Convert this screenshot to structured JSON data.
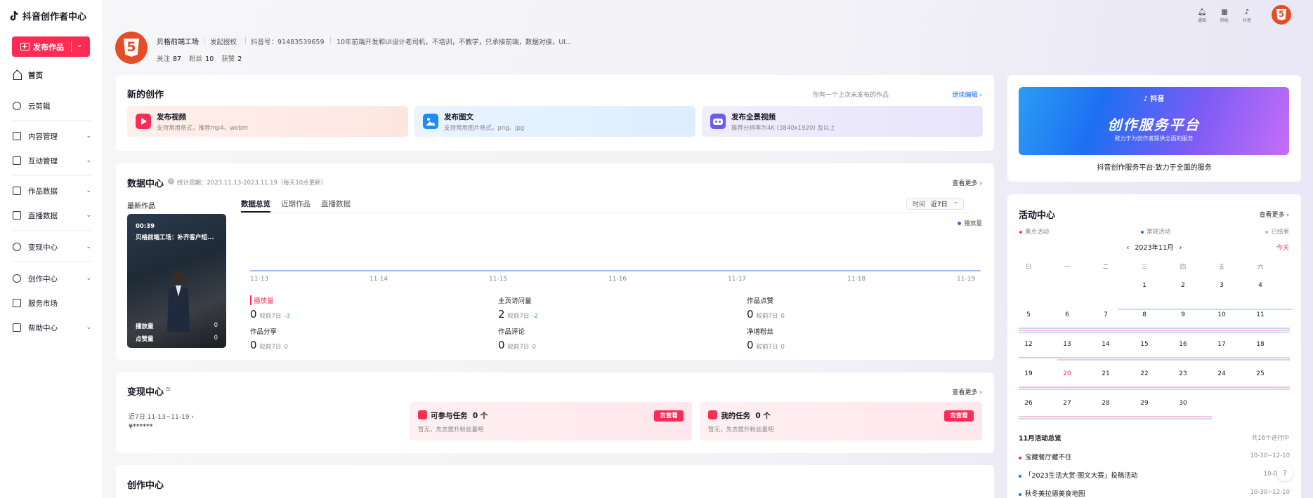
{
  "brand": {
    "title": "抖音创作者中心"
  },
  "sidebar": {
    "publish_label": "发布作品",
    "items": [
      {
        "label": "首页"
      },
      {
        "label": "云剪辑"
      },
      {
        "label": "内容管理"
      },
      {
        "label": "互动管理"
      },
      {
        "label": "作品数据"
      },
      {
        "label": "直播数据"
      },
      {
        "label": "变现中心"
      },
      {
        "label": "创作中心"
      },
      {
        "label": "服务市场"
      },
      {
        "label": "帮助中心"
      }
    ]
  },
  "topbar": {
    "notice": "通知",
    "site": "网址",
    "douyin": "抖音",
    "avatar_text": "5"
  },
  "profile": {
    "avatar_text": "5",
    "name": "贝格前端工场",
    "auth": "发起授权",
    "id": "抖音号：91483539659",
    "bio": "10年前端开发和UI设计老司机，不培训，不教学，只承接前端，数据对接，UI...",
    "following_label": "关注",
    "following": "87",
    "fans_label": "粉丝",
    "fans": "10",
    "likes_label": "获赞",
    "likes": "2"
  },
  "creation": {
    "title": "新的创作",
    "draft_hint": "你有一个上次未发布的作品",
    "draft_link": "继续编辑 ›",
    "tiles": [
      {
        "title": "发布视频",
        "sub": "支持常用格式，推荐mp4、webm"
      },
      {
        "title": "发布图文",
        "sub": "支持常用图片格式，png、jpg"
      },
      {
        "title": "发布全景视频",
        "sub": "推荐分辨率为4K (3840x1920) 及以上"
      }
    ]
  },
  "datacenter": {
    "title": "数据中心",
    "period": "统计周期：2023.11.13-2023.11.19（每天10点更新）",
    "more": "查看更多 ›",
    "latest_label": "最新作品",
    "cover": {
      "duration": "00:39",
      "title": "贝格前端工场：补齐客户短...",
      "plays_label": "播放量",
      "plays": "0",
      "likes_label": "点赞量",
      "likes": "0"
    },
    "tabs": [
      "数据总览",
      "近期作品",
      "直播数据"
    ],
    "range_label": "时间",
    "range_value": "近7日",
    "legend": "播放量",
    "xaxis": [
      "11-13",
      "11-14",
      "11-15",
      "11-16",
      "11-17",
      "11-18",
      "11-19"
    ],
    "metrics": [
      {
        "label": "播放量",
        "value": "0",
        "cmp": "较前7日",
        "delta": "-3"
      },
      {
        "label": "主页访问量",
        "value": "2",
        "cmp": "较前7日",
        "delta": "-2"
      },
      {
        "label": "作品点赞",
        "value": "0",
        "cmp": "较前7日",
        "delta": "0"
      },
      {
        "label": "作品分享",
        "value": "0",
        "cmp": "较前7日",
        "delta": "0"
      },
      {
        "label": "作品评论",
        "value": "0",
        "cmp": "较前7日",
        "delta": "0"
      },
      {
        "label": "净增粉丝",
        "value": "0",
        "cmp": "较前7日",
        "delta": "0"
      }
    ]
  },
  "monetize": {
    "title": "变现中心",
    "more": "查看更多 ›",
    "period": "近7日 11-13~11-19 ›",
    "income": "¥******",
    "tasks": [
      {
        "title": "可参与任务",
        "count": "0 个",
        "sub": "暂无，先去提升粉丝量吧",
        "btn": "去查看"
      },
      {
        "title": "我的任务",
        "count": "0 个",
        "sub": "暂无，先去提升粉丝量吧",
        "btn": "去查看"
      }
    ]
  },
  "studio": {
    "title": "创作中心"
  },
  "service": {
    "banner_top": "抖音",
    "banner_main": "创作服务平台",
    "banner_sub": "致力于为创作者提供全面的服务",
    "caption": "抖音创作服务平台·致力于全面的服务"
  },
  "activity": {
    "title": "活动中心",
    "more": "查看更多 ›",
    "legend": [
      "重点活动",
      "常规活动",
      "已结束"
    ],
    "month": "2023年11月",
    "today": "今天",
    "weekdays": [
      "日",
      "一",
      "二",
      "三",
      "四",
      "五",
      "六"
    ],
    "days": [
      "1",
      "2",
      "3",
      "4",
      "5",
      "6",
      "7",
      "8",
      "9",
      "10",
      "11",
      "12",
      "13",
      "14",
      "15",
      "16",
      "17",
      "18",
      "19",
      "20",
      "21",
      "22",
      "23",
      "24",
      "25",
      "26",
      "27",
      "28",
      "29",
      "30"
    ],
    "summary_title": "11月活动总览",
    "summary_count": "共16个进行中",
    "events": [
      {
        "name": "宝藏餐厅藏不住",
        "date": "10-30~12-10"
      },
      {
        "name": "「2023生活大赏·图文大赛」投稿活动",
        "date": "10-09~1"
      },
      {
        "name": "秋冬美拉德美食地图",
        "date": "10-30~12-10"
      }
    ]
  },
  "colors": {
    "accent": "#fe2c55",
    "brand_blue": "#1d6ff2",
    "h5": "#e44d26"
  }
}
